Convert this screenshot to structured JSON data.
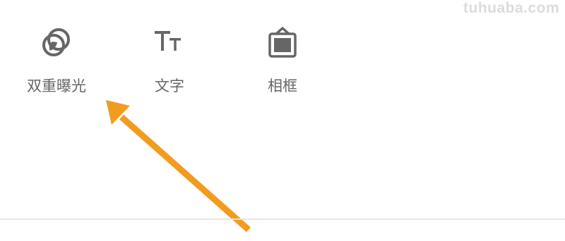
{
  "watermark": "tuhuaba.com",
  "tools": [
    {
      "label": "双重曝光",
      "icon": "double-exposure-icon"
    },
    {
      "label": "文字",
      "icon": "text-icon"
    },
    {
      "label": "相框",
      "icon": "frame-icon"
    }
  ],
  "colors": {
    "icon": "#666666",
    "label": "#666666",
    "arrow": "#f29c1f",
    "divider": "#e6e6e6",
    "watermark": "#dcdcdc"
  }
}
